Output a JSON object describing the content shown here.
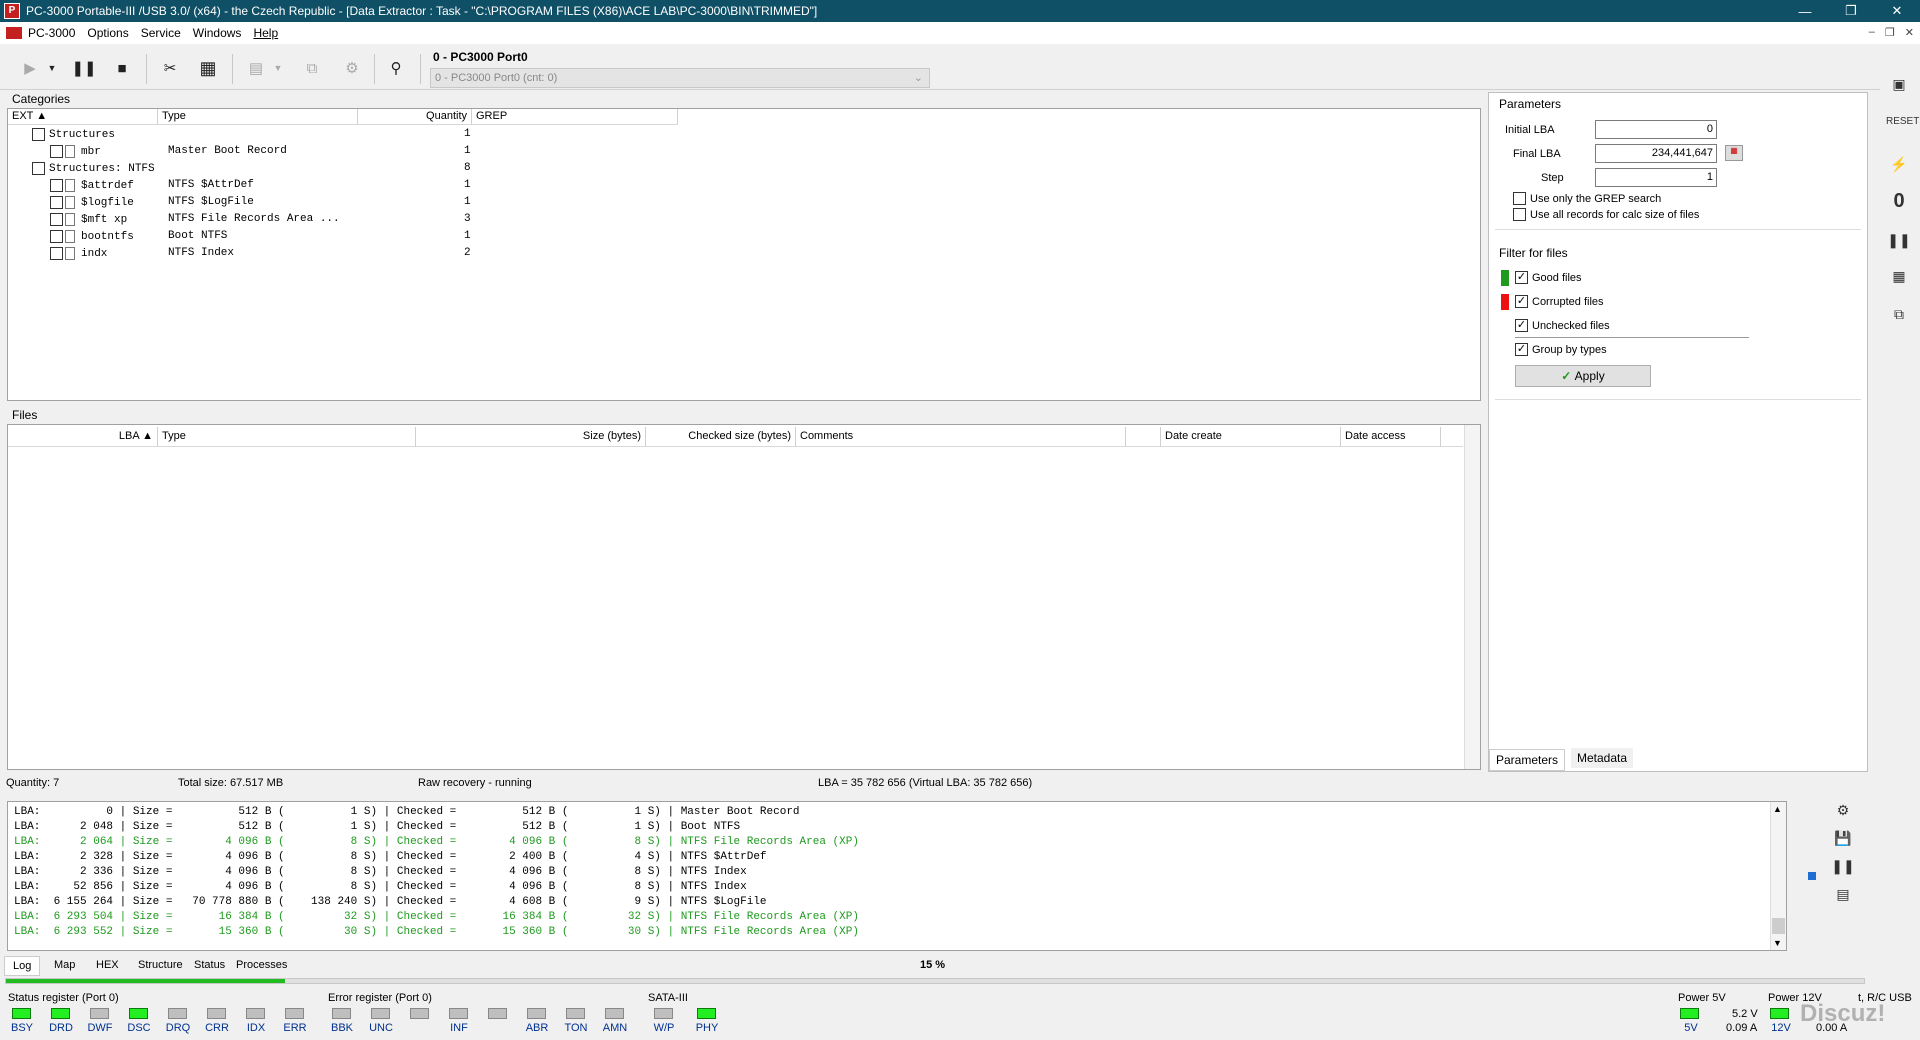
{
  "window": {
    "title": "PC-3000 Portable-III /USB 3.0/ (x64) - the Czech Republic - [Data Extractor : Task - \"C:\\PROGRAM FILES (X86)\\ACE LAB\\PC-3000\\BIN\\TRIMMED\"]",
    "minimize": "—",
    "maximize": "❐",
    "close": "✕"
  },
  "menu": {
    "items": [
      "PC-3000",
      "Options",
      "Service",
      "Windows",
      "Help"
    ]
  },
  "toolbar": {
    "port_label": "0 - PC3000 Port0",
    "port_select": "0 - PC3000 Port0 (cnt: 0)"
  },
  "categories": {
    "title": "Categories",
    "columns": [
      "EXT",
      "Type",
      "Quantity",
      "GREP"
    ],
    "groups": [
      {
        "name": "Structures",
        "qty": "1",
        "items": [
          {
            "ext": "mbr",
            "type": "Master Boot Record",
            "qty": "1"
          }
        ]
      },
      {
        "name": "Structures: NTFS",
        "qty": "8",
        "items": [
          {
            "ext": "$attrdef",
            "type": "NTFS $AttrDef",
            "qty": "1"
          },
          {
            "ext": "$logfile",
            "type": "NTFS $LogFile",
            "qty": "1"
          },
          {
            "ext": "$mft xp",
            "type": "NTFS File Records Area ...",
            "qty": "3"
          },
          {
            "ext": "bootntfs",
            "type": "Boot NTFS",
            "qty": "1"
          },
          {
            "ext": "indx",
            "type": "NTFS Index",
            "qty": "2"
          }
        ]
      }
    ]
  },
  "files": {
    "title": "Files",
    "columns": [
      "LBA",
      "Type",
      "Size (bytes)",
      "Checked size (bytes)",
      "Comments",
      "",
      "Date create",
      "Date access"
    ]
  },
  "parameters": {
    "title": "Parameters",
    "initial_lba_label": "Initial LBA",
    "initial_lba": "0",
    "final_lba_label": "Final  LBA",
    "final_lba": "234,441,647",
    "step_label": "Step",
    "step": "1",
    "grep_only": "Use only the GREP search",
    "all_records": "Use all records for calc size of files",
    "filter_title": "Filter for files",
    "good": "Good files",
    "corrupted": "Corrupted files",
    "unchecked": "Unchecked files",
    "group": "Group by types",
    "apply": "Apply",
    "tab_params": "Parameters",
    "tab_meta": "Metadata",
    "good_color": "#1f9a1f",
    "corrupted_color": "#ee1111"
  },
  "status": {
    "quantity": "Quantity: 7",
    "total_size": "Total size: 67.517 MB",
    "mode": "Raw recovery - running",
    "lba": "LBA = 35 782 656 (Virtual LBA: 35 782 656)"
  },
  "log": {
    "lines": [
      {
        "text": "LBA:          0 | Size =          512 B (          1 S) | Checked =          512 B (          1 S) | Master Boot Record",
        "color": "black"
      },
      {
        "text": "LBA:      2 048 | Size =          512 B (          1 S) | Checked =          512 B (          1 S) | Boot NTFS",
        "color": "black"
      },
      {
        "text": "LBA:      2 064 | Size =        4 096 B (          8 S) | Checked =        4 096 B (          8 S) | NTFS File Records Area (XP)",
        "color": "green"
      },
      {
        "text": "LBA:      2 328 | Size =        4 096 B (          8 S) | Checked =        2 400 B (          4 S) | NTFS $AttrDef",
        "color": "black"
      },
      {
        "text": "LBA:      2 336 | Size =        4 096 B (          8 S) | Checked =        4 096 B (          8 S) | NTFS Index",
        "color": "black"
      },
      {
        "text": "LBA:     52 856 | Size =        4 096 B (          8 S) | Checked =        4 096 B (          8 S) | NTFS Index",
        "color": "black"
      },
      {
        "text": "LBA:  6 155 264 | Size =   70 778 880 B (    138 240 S) | Checked =        4 608 B (          9 S) | NTFS $LogFile",
        "color": "black"
      },
      {
        "text": "LBA:  6 293 504 | Size =       16 384 B (         32 S) | Checked =       16 384 B (         32 S) | NTFS File Records Area (XP)",
        "color": "green"
      },
      {
        "text": "LBA:  6 293 552 | Size =       15 360 B (         30 S) | Checked =       15 360 B (         30 S) | NTFS File Records Area (XP)",
        "color": "green"
      }
    ]
  },
  "bottom_tabs": [
    "Log",
    "Map",
    "HEX",
    "Structure",
    "Status",
    "Processes"
  ],
  "progress": {
    "text": "15 %",
    "value": 0.15
  },
  "registers": {
    "status_title": "Status register (Port 0)",
    "status": [
      {
        "n": "BSY",
        "on": true
      },
      {
        "n": "DRD",
        "on": true
      },
      {
        "n": "DWF",
        "on": false
      },
      {
        "n": "DSC",
        "on": true
      },
      {
        "n": "DRQ",
        "on": false
      },
      {
        "n": "CRR",
        "on": false
      },
      {
        "n": "IDX",
        "on": false
      },
      {
        "n": "ERR",
        "on": false
      }
    ],
    "error_title": "Error register (Port 0)",
    "error": [
      {
        "n": "BBK",
        "on": false
      },
      {
        "n": "UNC",
        "on": false
      },
      {
        "n": "",
        "on": false
      },
      {
        "n": "INF",
        "on": false
      },
      {
        "n": "",
        "on": false
      },
      {
        "n": "ABR",
        "on": false
      },
      {
        "n": "TON",
        "on": false
      },
      {
        "n": "AMN",
        "on": false
      }
    ],
    "sata_title": "SATA-III",
    "sata": [
      {
        "n": "W/P",
        "on": false
      },
      {
        "n": "PHY",
        "on": true
      }
    ],
    "power5_title": "Power 5V",
    "power5_v": "5.2 V",
    "power5_a": "0.09 A",
    "power5_led": "5V",
    "power12_title": "Power 12V",
    "power12_led": "12V",
    "power12_a": "0.00 A",
    "extra": "t, R/C USB",
    "watermark": "Discuz!"
  }
}
